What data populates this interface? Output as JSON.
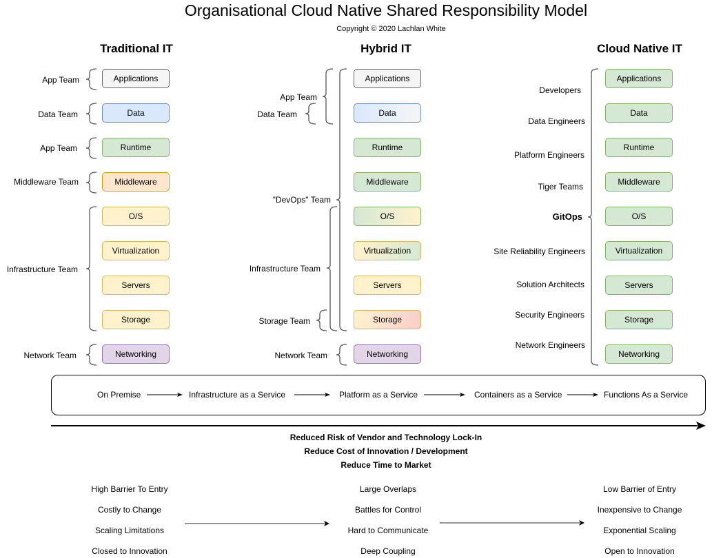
{
  "title": "Organisational Cloud Native Shared Responsibility Model",
  "copyright": "Copyright © 2020 Lachlan White",
  "columns": {
    "traditional": {
      "title": "Traditional IT",
      "layers": [
        {
          "label": "Applications",
          "fill": "#f5f5f5",
          "stroke": "#666666"
        },
        {
          "label": "Data",
          "fill": "#dae8fc",
          "stroke": "#6c8ebf"
        },
        {
          "label": "Runtime",
          "fill": "#d5e8d4",
          "stroke": "#82b366"
        },
        {
          "label": "Middleware",
          "fill": "#ffe6cc",
          "stroke": "#d79b00"
        },
        {
          "label": "O/S",
          "fill": "#fff2cc",
          "stroke": "#d6b656"
        },
        {
          "label": "Virtualization",
          "fill": "#fff2cc",
          "stroke": "#d6b656"
        },
        {
          "label": "Servers",
          "fill": "#fff2cc",
          "stroke": "#d6b656"
        },
        {
          "label": "Storage",
          "fill": "#fff2cc",
          "stroke": "#d6b656"
        },
        {
          "label": "Networking",
          "fill": "#e1d5e7",
          "stroke": "#9673a6"
        }
      ],
      "teams": [
        "App Team",
        "Data Team",
        "App Team",
        "Middleware Team",
        "Infrastructure Team",
        "Network Team"
      ]
    },
    "hybrid": {
      "title": "Hybrid IT",
      "layers": [
        {
          "label": "Applications",
          "fill": "#f5f5f5",
          "stroke": "#666666"
        },
        {
          "label": "Data",
          "fill": "#dae8fc",
          "stroke": "#6c8ebf",
          "fill2": "#f5f5f5"
        },
        {
          "label": "Runtime",
          "fill": "#d5e8d4",
          "stroke": "#82b366"
        },
        {
          "label": "Middleware",
          "fill": "#d5e8d4",
          "stroke": "#82b366"
        },
        {
          "label": "O/S",
          "fill": "#d5e8d4",
          "stroke": "#82b366",
          "fill2": "#fff2cc"
        },
        {
          "label": "Virtualization",
          "fill": "#fff2cc",
          "stroke": "#d6b656",
          "fill2": "#d5e8d4"
        },
        {
          "label": "Servers",
          "fill": "#fff2cc",
          "stroke": "#d6b656"
        },
        {
          "label": "Storage",
          "fill": "#fff2cc",
          "stroke": "#d6b656",
          "fill2": "#f8cecc"
        },
        {
          "label": "Networking",
          "fill": "#e1d5e7",
          "stroke": "#9673a6"
        }
      ],
      "teams": [
        "App Team",
        "Data Team",
        "\"DevOps\" Team",
        "Infrastructure Team",
        "Storage Team",
        "Network Team"
      ]
    },
    "cloud_native": {
      "title": "Cloud Native IT",
      "layers": [
        {
          "label": "Applications",
          "fill": "#d5e8d4",
          "stroke": "#82b366"
        },
        {
          "label": "Data",
          "fill": "#d5e8d4",
          "stroke": "#82b366"
        },
        {
          "label": "Runtime",
          "fill": "#d5e8d4",
          "stroke": "#82b366"
        },
        {
          "label": "Middleware",
          "fill": "#d5e8d4",
          "stroke": "#82b366"
        },
        {
          "label": "O/S",
          "fill": "#d5e8d4",
          "stroke": "#82b366"
        },
        {
          "label": "Virtualization",
          "fill": "#d5e8d4",
          "stroke": "#82b366"
        },
        {
          "label": "Servers",
          "fill": "#d5e8d4",
          "stroke": "#82b366"
        },
        {
          "label": "Storage",
          "fill": "#d5e8d4",
          "stroke": "#82b366"
        },
        {
          "label": "Networking",
          "fill": "#d5e8d4",
          "stroke": "#82b366"
        }
      ],
      "roles": [
        "Developers",
        "Data Engineers",
        "Platform Engineers",
        "Tiger Teams",
        "GitOps",
        "Site Reliability Engineers",
        "Solution Architects",
        "Security Engineers",
        "Network Engineers"
      ]
    }
  },
  "service_flow": [
    "On Premise",
    "Infrastructure as a Service",
    "Platform as a Service",
    "Containers as a Service",
    "Functions As a Service"
  ],
  "benefits": [
    "Reduced Risk of Vendor and Technology Lock-In",
    "Reduce Cost of Innovation / Development",
    "Reduce Time to Market"
  ],
  "traits": {
    "traditional": [
      "High Barrier To Entry",
      "Costly to Change",
      "Scaling Limitations",
      "Closed to Innovation"
    ],
    "hybrid": [
      "Large Overlaps",
      "Battles for Control",
      "Hard to Communicate",
      "Deep Coupling"
    ],
    "cloud_native": [
      "Low Barrier of Entry",
      "Inexpensive to Change",
      "Exponential Scaling",
      "Open to Innovation"
    ]
  }
}
